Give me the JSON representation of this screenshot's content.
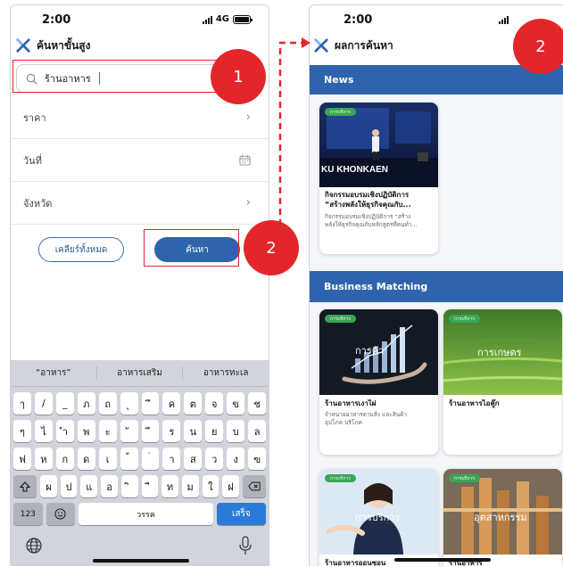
{
  "left_screen": {
    "status_time": "2:00",
    "network": "4G",
    "title": "ค้นหาขั้นสูง",
    "search_value": "ร้านอาหาร",
    "filters": [
      {
        "label": "ราคา",
        "icon": "chevron-right-icon"
      },
      {
        "label": "วันที่",
        "icon": "calendar-icon"
      },
      {
        "label": "จังหวัด",
        "icon": "chevron-right-icon"
      }
    ],
    "clear_label": "เคลียร์ทั้งหมด",
    "search_label": "ค้นหา",
    "keyboard": {
      "suggestions": [
        "“อาหาร”",
        "อาหารเสริม",
        "อาหารทะเล"
      ],
      "row1": [
        "ๅ",
        "/",
        "_",
        "ภ",
        "ถ",
        "ุ",
        "ึ",
        "ค",
        "ต",
        "จ",
        "ข",
        "ช"
      ],
      "row2": [
        "ๆ",
        "ไ",
        "ำ",
        "พ",
        "ะ",
        "ั",
        "ี",
        "ร",
        "น",
        "ย",
        "บ",
        "ล"
      ],
      "row3": [
        "ฟ",
        "ห",
        "ก",
        "ด",
        "เ",
        "้",
        "่",
        "า",
        "ส",
        "ว",
        "ง",
        "ฃ"
      ],
      "row4": [
        "ผ",
        "ป",
        "แ",
        "อ",
        "ิ",
        "ื",
        "ท",
        "ม",
        "ใ",
        "ฝ"
      ],
      "numbers_label": "123",
      "space_label": "วรรค",
      "go_label": "เสร็จ"
    }
  },
  "right_screen": {
    "status_time": "2:00",
    "title": "ผลการค้นหา",
    "news_heading": "News",
    "news_card": {
      "tag": "การบริการ",
      "image_text": "KU KHONKAEN",
      "title_line1": "กิจกรรมอบรมเชิงปฏิบัติการ",
      "title_line2": "“สร้างพลังให้ธุรกิจคุณกับ...",
      "desc_line1": "กิจกรรมอบรมเชิงปฏิบัติการ “สร้าง",
      "desc_line2": "พลังให้ธุรกิจคุณกับหลักสูตรที่คนทำ..."
    },
    "business_heading": "Business Matching",
    "business_cards": [
      {
        "tag": "การบริการ",
        "image_text": "การค้า",
        "title": "ร้านอาหารเงาไผ่",
        "desc_line1": "จำหน่ายอาหารตามสั่ง และสินค้า",
        "desc_line2": "อุปโภค บริโภค"
      },
      {
        "tag": "การบริการ",
        "image_text": "การเกษตร",
        "title": "ร้านอาหารไอคู๊ก",
        "desc_line1": "",
        "desc_line2": ""
      },
      {
        "tag": "การบริการ",
        "image_text": "การบริการ",
        "title": "ร้านอาหารออนซอน",
        "desc_line1": "",
        "desc_line2": ""
      },
      {
        "tag": "การบริการ",
        "image_text": "อุตสาหกรรม",
        "title": "ร้านอาหาร",
        "desc_line1": "",
        "desc_line2": ""
      }
    ]
  },
  "annotations": {
    "marker_1": "1",
    "marker_2": "2",
    "marker_3": "2"
  },
  "colors": {
    "brand_blue": "#2f64ad",
    "highlight_red": "#e3262b",
    "tag_green": "#3aa655"
  }
}
